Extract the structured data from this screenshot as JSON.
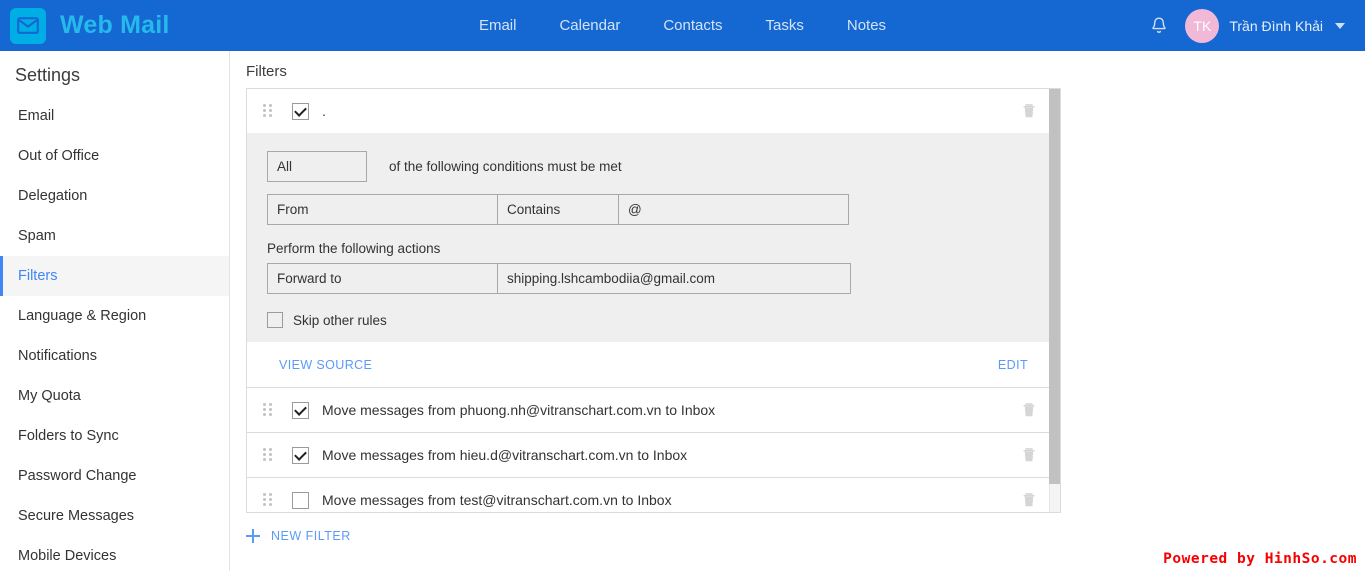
{
  "header": {
    "brand_title": "Web Mail",
    "logo_icon": "envelope-icon",
    "nav": [
      {
        "label": "Email"
      },
      {
        "label": "Calendar"
      },
      {
        "label": "Contacts"
      },
      {
        "label": "Tasks"
      },
      {
        "label": "Notes"
      }
    ],
    "bell_icon": "bell-icon",
    "avatar_initials": "TK",
    "user_name": "Trần Đình Khải",
    "caret_icon": "chevron-down-icon",
    "bar_color": "#1568d2",
    "brand_color": "#25b9ec",
    "avatar_color": "#f2b8d8"
  },
  "sidebar": {
    "title": "Settings",
    "active_color": "#4285f4",
    "items": [
      {
        "label": "Email",
        "active": false
      },
      {
        "label": "Out of Office",
        "active": false
      },
      {
        "label": "Delegation",
        "active": false
      },
      {
        "label": "Spam",
        "active": false
      },
      {
        "label": "Filters",
        "active": true
      },
      {
        "label": "Language & Region",
        "active": false
      },
      {
        "label": "Notifications",
        "active": false
      },
      {
        "label": "My Quota",
        "active": false
      },
      {
        "label": "Folders to Sync",
        "active": false
      },
      {
        "label": "Password Change",
        "active": false
      },
      {
        "label": "Secure Messages",
        "active": false
      },
      {
        "label": "Mobile Devices",
        "active": false
      }
    ]
  },
  "main": {
    "page_title": "Filters",
    "expanded_filter": {
      "drag_handle_icon": "drag-handle-icon",
      "enabled": true,
      "name": ".",
      "delete_icon": "trash-icon",
      "match_select_value": "All",
      "match_text": "of the following conditions must be met",
      "condition": {
        "field": "From",
        "operator": "Contains",
        "value": "@"
      },
      "actions_label": "Perform the following actions",
      "action": {
        "type": "Forward to",
        "value": "shipping.lshcambodiia@gmail.com"
      },
      "skip_other_rules_label": "Skip other rules",
      "skip_other_rules_checked": false,
      "view_source_label": "View source",
      "edit_label": "Edit"
    },
    "filter_rows": [
      {
        "enabled": true,
        "label": "Move messages from phuong.nh@vitranschart.com.vn to Inbox",
        "drag_handle_icon": "drag-handle-icon",
        "delete_icon": "trash-icon"
      },
      {
        "enabled": true,
        "label": "Move messages from hieu.d@vitranschart.com.vn to Inbox",
        "drag_handle_icon": "drag-handle-icon",
        "delete_icon": "trash-icon"
      },
      {
        "enabled": false,
        "label": "Move messages from test@vitranschart.com.vn to Inbox",
        "drag_handle_icon": "drag-handle-icon",
        "delete_icon": "trash-icon"
      }
    ],
    "new_filter_label": "New filter",
    "new_filter_icon": "plus-icon",
    "link_color": "#5b9bf8"
  },
  "footer": {
    "watermark": "Powered by HinhSo.com",
    "watermark_color": "#f60000"
  }
}
